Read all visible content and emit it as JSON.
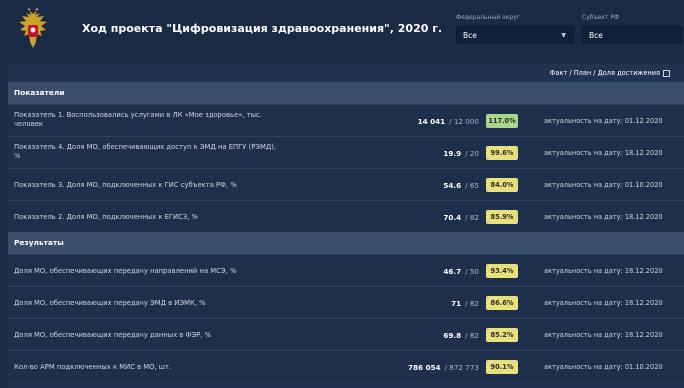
{
  "header": {
    "title": "Ход проекта \"Цифровизация здравоохранения\", 2020 г.",
    "filters": {
      "district_label": "Федеральный округ",
      "district_value": "Все",
      "subject_label": "Субъект РФ",
      "subject_value": "Все"
    }
  },
  "toggle": {
    "label": "Факт / План / Доля достижения"
  },
  "colors": {
    "green_badge": "#a6d88a",
    "yellow_badge": "#e8e07a",
    "header_bg": "#1a2a45",
    "section_bg": "#3a4d6c"
  },
  "sections": [
    {
      "title": "Показатели",
      "rows": [
        {
          "label": "Показатель 1. Воспользовались услугами в ЛК «Мое здоровье», тыс. человек",
          "fact": "14 041",
          "plan": "/ 12 000",
          "percent": "117.0%",
          "badge": "green",
          "date_label": "актуальность на дату:",
          "date": "01.12.2020"
        },
        {
          "label": "Показатель 4. Доля МО, обеспечивающих доступ к ЭМД на ЕПГУ (РЭМД), %",
          "fact": "19.9",
          "plan": "/ 20",
          "percent": "99.6%",
          "badge": "yellow",
          "date_label": "актуальность на дату:",
          "date": "18.12.2020"
        },
        {
          "label": "Показатель 3. Доля МО, подключенных к ГИС субъекта РФ, %",
          "fact": "54.6",
          "plan": "/ 65",
          "percent": "84.0%",
          "badge": "yellow",
          "date_label": "актуальность на дату:",
          "date": "01.10.2020"
        },
        {
          "label": "Показатель 2. Доля МО, подключенных к ЕГИСЗ, %",
          "fact": "70.4",
          "plan": "/ 82",
          "percent": "85.9%",
          "badge": "yellow",
          "date_label": "актуальность на дату:",
          "date": "18.12.2020"
        }
      ]
    },
    {
      "title": "Результаты",
      "rows": [
        {
          "label": "Доля МО, обеспечивающих передачу направлений на МСЭ, %",
          "fact": "46.7",
          "plan": "/ 50",
          "percent": "93.4%",
          "badge": "yellow",
          "date_label": "актуальность на дату:",
          "date": "18.12.2020"
        },
        {
          "label": "Доля МО, обеспечивающих передачу ЭМД в ИЭМК, %",
          "fact": "71",
          "plan": "/ 82",
          "percent": "86.6%",
          "badge": "yellow",
          "date_label": "актуальность на дату:",
          "date": "18.12.2020"
        },
        {
          "label": "Доля МО, обеспечивающих передачу данных в ФЭР, %",
          "fact": "69.8",
          "plan": "/ 82",
          "percent": "85.2%",
          "badge": "yellow",
          "date_label": "актуальность на дату:",
          "date": "18.12.2020"
        },
        {
          "label": "Кол-во АРМ подключенных к МИС в МО, шт.",
          "fact": "786 054",
          "plan": "/ 872 773",
          "percent": "90.1%",
          "badge": "yellow",
          "date_label": "актуальность на дату:",
          "date": "01.10.2020"
        }
      ]
    }
  ]
}
